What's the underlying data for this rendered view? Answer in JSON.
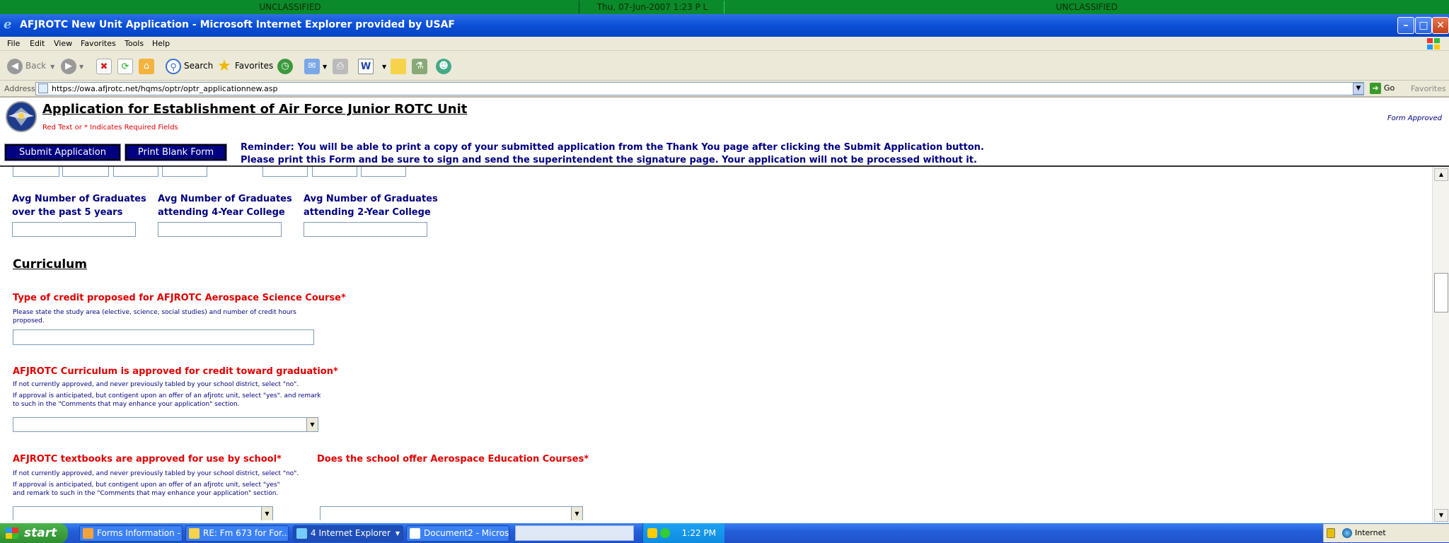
{
  "banner": {
    "left": "UNCLASSIFIED",
    "center": "Thu, 07-Jun-2007 1:23 P L",
    "right": "UNCLASSIFIED"
  },
  "window": {
    "title": "AFJROTC New Unit Application - Microsoft Internet Explorer provided by USAF",
    "minimize": "–",
    "maximize": "□",
    "close": "✕"
  },
  "menu": [
    "File",
    "Edit",
    "View",
    "Favorites",
    "Tools",
    "Help"
  ],
  "toolbar": {
    "back": "Back",
    "search": "Search",
    "favorites": "Favorites"
  },
  "address": {
    "label": "Address",
    "url": "https://owa.afjrotc.net/hqms/optr/optr_applicationnew.asp",
    "go": "Go",
    "favorites": "Favorites"
  },
  "header": {
    "title": "Application for Establishment of Air Force Junior ROTC Unit",
    "required_note": "Red Text or * Indicates Required Fields",
    "form_approved": "Form Approved",
    "submit_label": "Submit Application",
    "print_label": "Print Blank Form",
    "reminder_line1": "Reminder: You will be able to print a copy of your submitted application from the Thank You page after clicking the Submit Application button.",
    "reminder_line2": "Please print this Form and be sure to sign and send the superintendent the signature page. Your application will not be processed without it."
  },
  "graduates": {
    "past5_line1": "Avg Number of Graduates",
    "past5_line2": "over the past 5 years",
    "college4_line1": "Avg Number of Graduates",
    "college4_line2": "attending 4-Year College",
    "college2_line1": "Avg Number of Graduates",
    "college2_line2": "attending 2-Year College"
  },
  "curriculum": {
    "heading": "Curriculum",
    "credit_type_label": "Type of credit proposed for AFJROTC Aerospace Science Course*",
    "credit_type_help1": "Please state the study area (elective, science, social studies) and number of credit hours",
    "credit_type_help2": "proposed.",
    "approved_label": "AFJROTC Curriculum is approved for credit toward graduation*",
    "approved_help1": "If not currently approved, and never previously tabled by your school district, select \"no\".",
    "approved_help2": "If approval is anticipated, but contigent upon an offer of an afjrotc unit, select \"yes\". and remark",
    "approved_help3": "to such in the \"Comments that may enhance your application\" section.",
    "textbooks_label": "AFJROTC textbooks are approved for use by school*",
    "textbooks_help1": "If not currently approved, and never previously tabled by your school district, select \"no\".",
    "textbooks_help2": "If approval is anticipated, but contigent upon an offer of an afjrotc unit, select \"yes\"",
    "textbooks_help3": "and remark to such in the \"Comments that may enhance your application\" section.",
    "aerospace_label": "Does the school offer Aerospace Education Courses*"
  },
  "status": {
    "zone": "Internet"
  },
  "taskbar": {
    "start": "start",
    "tasks": [
      "Forms Information - ...",
      "RE: Fm 673 for For...",
      "4 Internet Explorer",
      "Document2 - Micros..."
    ],
    "clock": "1:22 PM"
  },
  "colors": {
    "navy": "#000080",
    "required_red": "#e00000",
    "banner_green": "#0a8a2a"
  }
}
